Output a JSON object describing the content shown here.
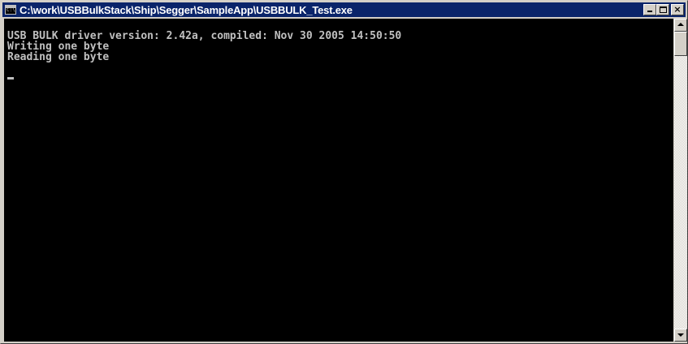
{
  "window": {
    "title": "C:\\work\\USBBulkStack\\Ship\\Segger\\SampleApp\\USBBULK_Test.exe",
    "icon": "console-app-icon",
    "controls": {
      "minimize": "minimize-icon",
      "maximize": "maximize-icon",
      "close": "×"
    }
  },
  "console": {
    "lines": [
      "USB BULK driver version: 2.42a, compiled: Nov 30 2005 14:50:50",
      "Writing one byte",
      "Reading one byte"
    ],
    "text_color": "#c0c0c0",
    "background": "#000000"
  },
  "colors": {
    "titlebar": "#0a246a",
    "chrome": "#d4d0c8"
  }
}
